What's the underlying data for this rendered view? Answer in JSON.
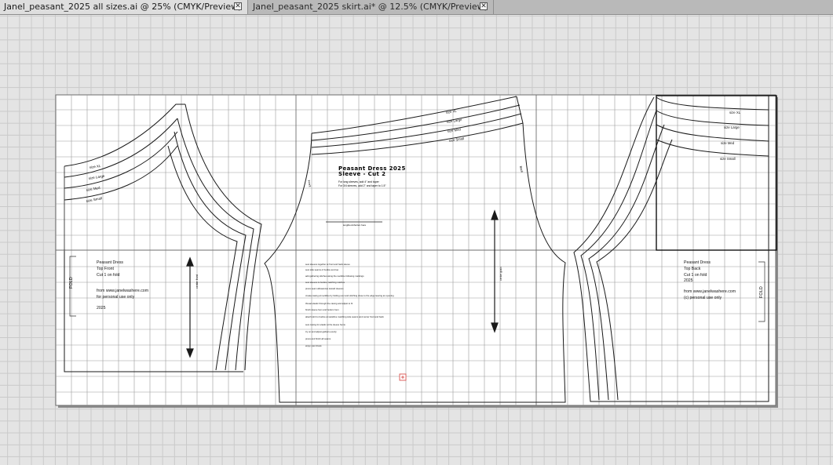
{
  "tabs": [
    {
      "label": "Janel_peasant_2025 all sizes.ai @ 25% (CMYK/Preview)",
      "active": true
    },
    {
      "label": "Janel_peasant_2025 skirt.ai* @ 12.5% (CMYK/Preview)",
      "active": false
    }
  ],
  "close_glyph": "✕",
  "front": {
    "sizes": [
      "size XL",
      "size Large",
      "size Med",
      "size Small"
    ],
    "lines": [
      "Peasant Dress",
      "Top Front",
      "Cut 1 on fold",
      "",
      "from www.janelwashere.com",
      "for personal use only",
      "",
      "2025"
    ],
    "fold": "FOLD",
    "grain": "center front"
  },
  "sleeve": {
    "title1": "Peasant Dress 2025",
    "title2": "Sleeve - Cut 2",
    "note1": "For long sleeves, add 4\" and taper",
    "note2": "For 3/4 sleeves, add 2\" and taper to 1.5\"",
    "sizes": [
      "size XL",
      "size Large",
      "size Med",
      "size Small"
    ],
    "front_mark": "Front",
    "back_mark": "Back",
    "shorten_line": "lengthen/shorten here",
    "grain": "center grain",
    "instructions": [
      "sew sleeves together at front and back sleeve",
      "sew side seams of bodice and top",
      "add gathering stitches along the neckline following markings",
      "sew sleeves to bodice matching notches",
      "press seam allowances toward sleeves",
      "create casing at neckline by folding over and stitching close to the edge leaving an opening",
      "thread elastic through the casing and adjust to fit",
      "finish sleeve hem and bottom hem",
      "attach skirt to bodice at waistline matching side seams and center front and back",
      "sew casing for elastic at the sleeve hems",
      "try on and adjust gathers evenly",
      "press and finish all seams",
      "enjoy your dress"
    ]
  },
  "back": {
    "sizes": [
      "size XL",
      "size Large",
      "size Med",
      "size Small"
    ],
    "lines": [
      "Peasant Dress",
      "Top Back",
      "Cut 1 on fold",
      "2025",
      "",
      "from www.janelwashere.com",
      "(c) personal use only"
    ],
    "fold": "FOLD"
  }
}
